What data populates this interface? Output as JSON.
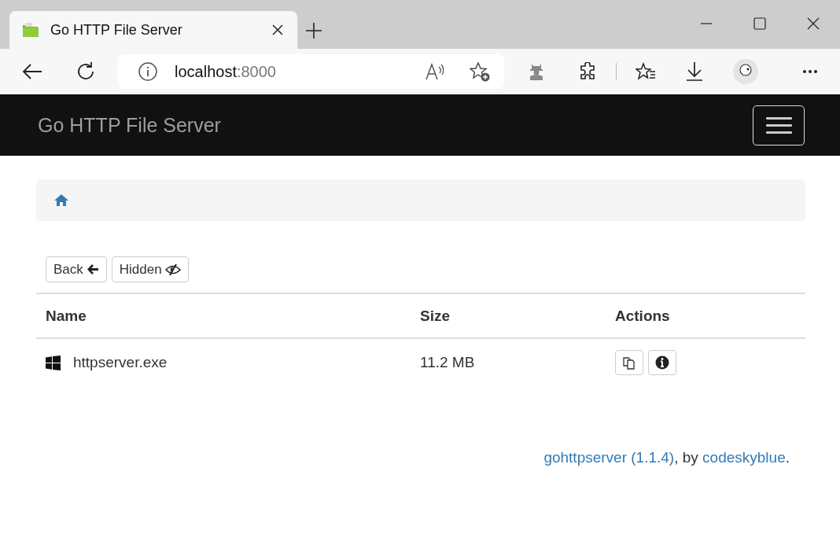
{
  "browser": {
    "tab_title": "Go HTTP File Server",
    "address_host": "localhost",
    "address_port": ":8000"
  },
  "navbar": {
    "brand": "Go HTTP File Server"
  },
  "toolbar": {
    "buttons": [
      {
        "label": "Back",
        "kind": "back"
      },
      {
        "label": "Hidden",
        "kind": "hidden"
      }
    ]
  },
  "table": {
    "columns": [
      "Name",
      "Size",
      "Actions"
    ],
    "rows": [
      {
        "name": "httpserver.exe",
        "size": "11.2 MB"
      }
    ]
  },
  "footer": {
    "project_link": "gohttpserver (1.1.4)",
    "separator": ", by ",
    "author_link": "codeskyblue",
    "end": "."
  }
}
